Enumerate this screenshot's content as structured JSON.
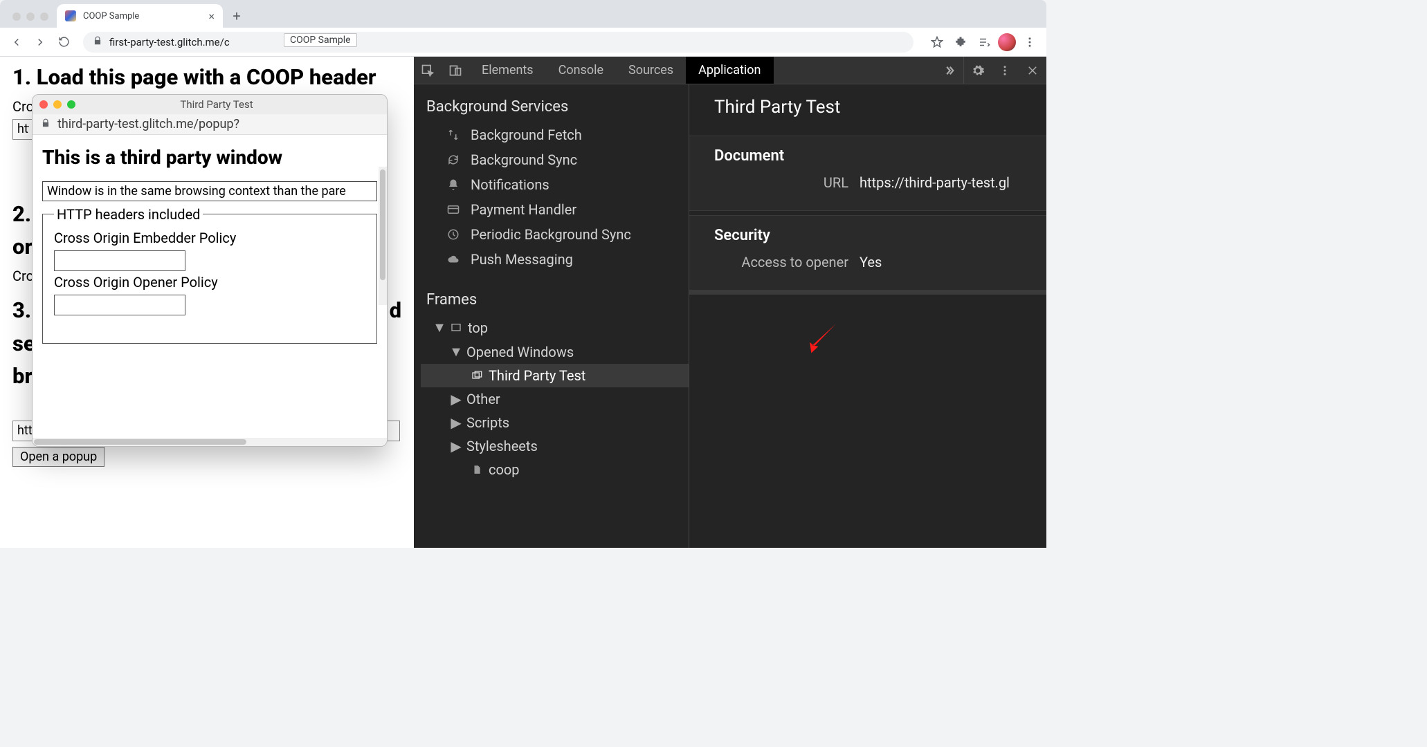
{
  "browser": {
    "tab_title": "COOP Sample",
    "url": "first-party-test.glitch.me/c",
    "title_tooltip": "COOP Sample"
  },
  "mainpage": {
    "h1": "1. Load this page with a COOP header",
    "line_coe_prefix": "Cro",
    "url_field_prefix": "http",
    "h2": "2.",
    "line_or": "or",
    "line_cro": "Cro",
    "h3_prefix": "3.",
    "h3_tail_d": "d",
    "line_se": "se",
    "line_br": "br",
    "popup_url_value": "https://third-party-test.glitch.me/popup?",
    "open_btn": "Open a popup"
  },
  "popup": {
    "title": "Third Party Test",
    "addr": "third-party-test.glitch.me/popup?",
    "heading": "This is a third party window",
    "status": "Window is in the same browsing context than the pare",
    "fieldset_legend": "HTTP headers included",
    "coep_label": "Cross Origin Embedder Policy",
    "coop_label": "Cross Origin Opener Policy",
    "coep_value": "",
    "coop_value": ""
  },
  "devtools": {
    "tabs": {
      "elements": "Elements",
      "console": "Console",
      "sources": "Sources",
      "application": "Application"
    },
    "side": {
      "bg_services": "Background Services",
      "items": {
        "bg_fetch": "Background Fetch",
        "bg_sync": "Background Sync",
        "notifications": "Notifications",
        "payment": "Payment Handler",
        "periodic": "Periodic Background Sync",
        "push": "Push Messaging"
      },
      "frames": "Frames",
      "top": "top",
      "opened_windows": "Opened Windows",
      "third_party_test": "Third Party Test",
      "other": "Other",
      "scripts": "Scripts",
      "stylesheets": "Stylesheets",
      "coop_leaf": "coop"
    },
    "detail": {
      "title": "Third Party Test",
      "document_h": "Document",
      "url_k": "URL",
      "url_v": "https://third-party-test.gl",
      "security_h": "Security",
      "access_k": "Access to opener",
      "access_v": "Yes"
    }
  }
}
